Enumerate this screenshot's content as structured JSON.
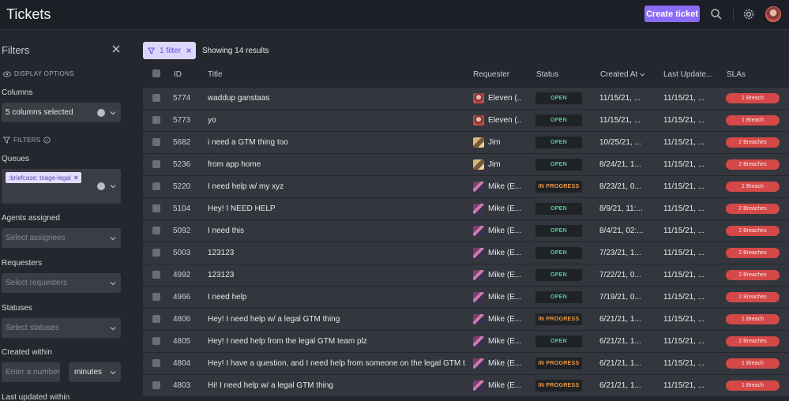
{
  "header": {
    "title": "Tickets",
    "create_label": "Create ticket",
    "icons": [
      "search-icon",
      "gear-icon"
    ]
  },
  "sidebar": {
    "title": "Filters",
    "display_options": "DISPLAY OPTIONS",
    "columns_label": "Columns",
    "columns_value": "5 columns selected",
    "filters_section": "FILTERS",
    "queues_label": "Queues",
    "queue_tag": ":briefcase: triage-legal",
    "agents_label": "Agents assigned",
    "agents_placeholder": "Select assignees",
    "requesters_label": "Requesters",
    "requesters_placeholder": "Select requesters",
    "statuses_label": "Statuses",
    "statuses_placeholder": "Select statuses",
    "created_label": "Created within",
    "created_placeholder": "Enter a number",
    "created_unit": "minutes",
    "updated_label": "Last updated within"
  },
  "main": {
    "filter_chip": "1 filter",
    "results": "Showing 14 results"
  },
  "table": {
    "headers": {
      "id": "ID",
      "title": "Title",
      "requester": "Requester",
      "status": "Status",
      "created": "Created At",
      "updated": "Last Update...",
      "slas": "SLAs"
    },
    "rows": [
      {
        "id": "5774",
        "title": "waddup ganstaas",
        "requester": "Eleven (...",
        "avatar": "eleven",
        "status": "OPEN",
        "status_kind": "open",
        "created": "11/15/21, ...",
        "updated": "11/15/21, ...",
        "sla": "1 Breach"
      },
      {
        "id": "5773",
        "title": "yo",
        "requester": "Eleven (...",
        "avatar": "eleven",
        "status": "OPEN",
        "status_kind": "open",
        "created": "11/15/21, ...",
        "updated": "11/15/21, ...",
        "sla": "1 Breach"
      },
      {
        "id": "5682",
        "title": "i need a GTM thing too",
        "requester": "Jim",
        "avatar": "jim",
        "status": "OPEN",
        "status_kind": "open",
        "created": "10/25/21, ...",
        "updated": "11/15/21, ...",
        "sla": "2 Breaches"
      },
      {
        "id": "5236",
        "title": "from app home",
        "requester": "Jim",
        "avatar": "jim",
        "status": "OPEN",
        "status_kind": "open",
        "created": "8/24/21, 1...",
        "updated": "11/15/21, ...",
        "sla": "2 Breaches"
      },
      {
        "id": "5220",
        "title": "I need help w/ my xyz",
        "requester": "Mike (E...",
        "avatar": "mike",
        "status": "IN PROGRESS",
        "status_kind": "prog",
        "created": "8/23/21, 0...",
        "updated": "11/15/21, ...",
        "sla": "1 Breach"
      },
      {
        "id": "5104",
        "title": "Hey! I NEED HELP",
        "requester": "Mike (E...",
        "avatar": "mike",
        "status": "OPEN",
        "status_kind": "open",
        "created": "8/9/21, 11:...",
        "updated": "11/15/21, ...",
        "sla": "2 Breaches"
      },
      {
        "id": "5092",
        "title": "I need this",
        "requester": "Mike (E...",
        "avatar": "mike",
        "status": "OPEN",
        "status_kind": "open",
        "created": "8/4/21, 02:...",
        "updated": "11/15/21, ...",
        "sla": "2 Breaches"
      },
      {
        "id": "5003",
        "title": "123123",
        "requester": "Mike (E...",
        "avatar": "mike",
        "status": "OPEN",
        "status_kind": "open",
        "created": "7/23/21, 1...",
        "updated": "11/15/21, ...",
        "sla": "2 Breaches"
      },
      {
        "id": "4992",
        "title": "123123",
        "requester": "Mike (E...",
        "avatar": "mike",
        "status": "OPEN",
        "status_kind": "open",
        "created": "7/22/21, 0...",
        "updated": "11/15/21, ...",
        "sla": "2 Breaches"
      },
      {
        "id": "4966",
        "title": "I need help",
        "requester": "Mike (E...",
        "avatar": "mike",
        "status": "OPEN",
        "status_kind": "open",
        "created": "7/19/21, 0...",
        "updated": "11/15/21, ...",
        "sla": "2 Breaches"
      },
      {
        "id": "4806",
        "title": "Hey! I need help w/ a legal GTM thing",
        "requester": "Mike (E...",
        "avatar": "mike",
        "status": "IN PROGRESS",
        "status_kind": "prog",
        "created": "6/21/21, 1...",
        "updated": "11/15/21, ...",
        "sla": "1 Breach"
      },
      {
        "id": "4805",
        "title": "Hey! I need help from the legal GTM team plz",
        "requester": "Mike (E...",
        "avatar": "mike",
        "status": "OPEN",
        "status_kind": "open",
        "created": "6/21/21, 1...",
        "updated": "11/15/21, ...",
        "sla": "2 Breaches"
      },
      {
        "id": "4804",
        "title": "Hey! I have a question, and I need help from someone on the legal GTM team",
        "requester": "Mike (E...",
        "avatar": "mike",
        "status": "IN PROGRESS",
        "status_kind": "prog",
        "created": "6/21/21, 1...",
        "updated": "11/15/21, ...",
        "sla": "1 Breach"
      },
      {
        "id": "4803",
        "title": "Hi! I need help w/ a legal GTM thing",
        "requester": "Mike (E...",
        "avatar": "mike",
        "status": "IN PROGRESS",
        "status_kind": "prog",
        "created": "6/21/21, 1...",
        "updated": "11/15/21, ...",
        "sla": "1 Breach"
      }
    ]
  },
  "colors": {
    "accent": "#8b6cf7",
    "open": "#4fd08a",
    "in_progress": "#f29a3e",
    "breach": "#d54848"
  }
}
